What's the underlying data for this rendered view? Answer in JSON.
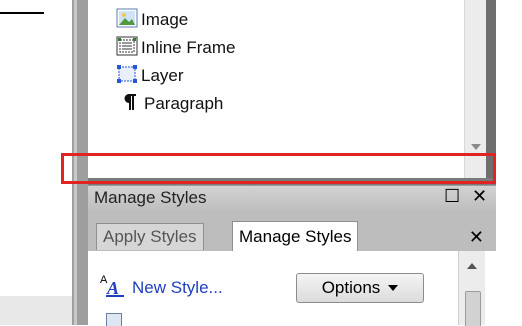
{
  "toolbox": {
    "items": [
      {
        "label": "Image",
        "icon": "image-icon"
      },
      {
        "label": "Inline Frame",
        "icon": "inline-frame-icon"
      },
      {
        "label": "Layer",
        "icon": "layer-icon"
      },
      {
        "label": "Paragraph",
        "icon": "paragraph-icon"
      }
    ]
  },
  "manage_styles_panel": {
    "title": "Manage Styles",
    "restore_glyph": "☐",
    "close_glyph": "✕",
    "tabs": [
      {
        "label": "Apply Styles",
        "active": false
      },
      {
        "label": "Manage Styles",
        "active": true
      }
    ],
    "tab_close_glyph": "✕",
    "new_style_label": "New Style...",
    "options_label": "Options"
  },
  "highlight": {
    "color": "#e02424"
  }
}
